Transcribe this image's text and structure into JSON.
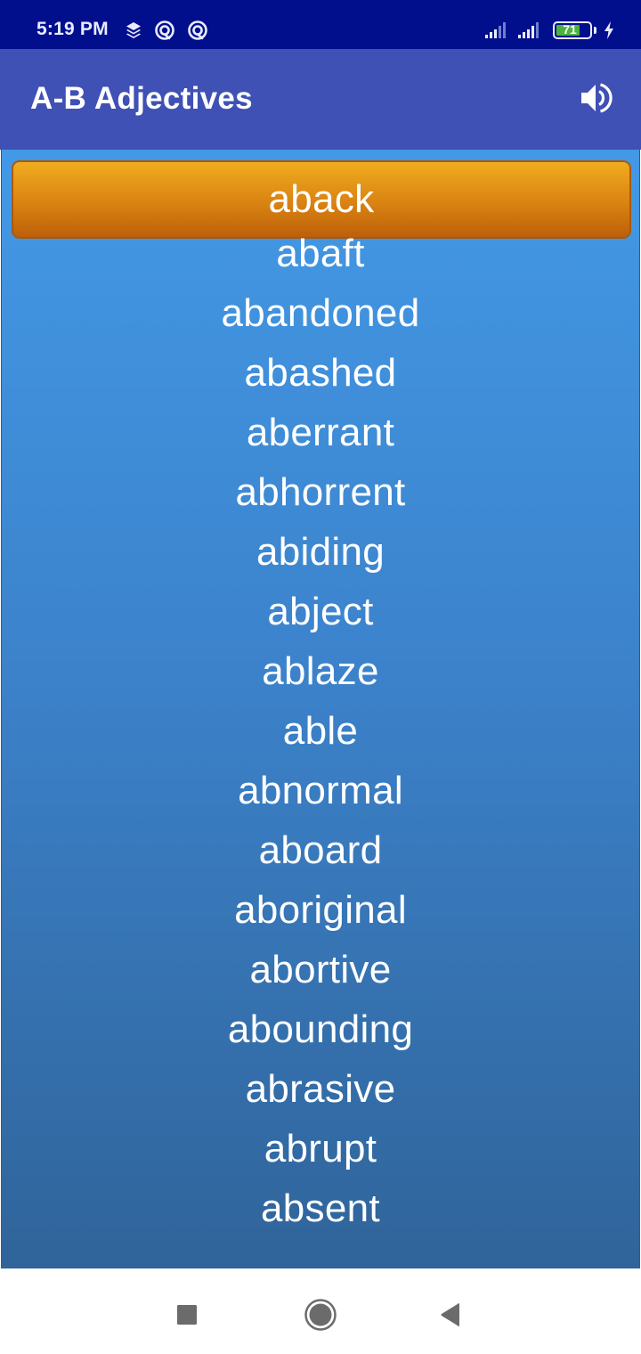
{
  "status_bar": {
    "time": "5:19 PM",
    "left_icons": [
      "layers-icon",
      "data-saver-icon",
      "data-saver-icon"
    ],
    "battery_level": "71",
    "battery_color": "#4bb33b",
    "charging": true
  },
  "app_bar": {
    "title": "A-B Adjectives",
    "background": "#3f51b5",
    "sound_icon": "volume-up-icon"
  },
  "word_list": {
    "selected_index": 0,
    "selected_color": "#e08a14",
    "items": [
      "aback",
      "abaft",
      "abandoned",
      "abashed",
      "aberrant",
      "abhorrent",
      "abiding",
      "abject",
      "ablaze",
      "able",
      "abnormal",
      "aboard",
      "aboriginal",
      "abortive",
      "abounding",
      "abrasive",
      "abrupt",
      "absent"
    ]
  },
  "nav_bar": {
    "buttons": [
      "recents-icon",
      "home-icon",
      "back-icon"
    ]
  }
}
